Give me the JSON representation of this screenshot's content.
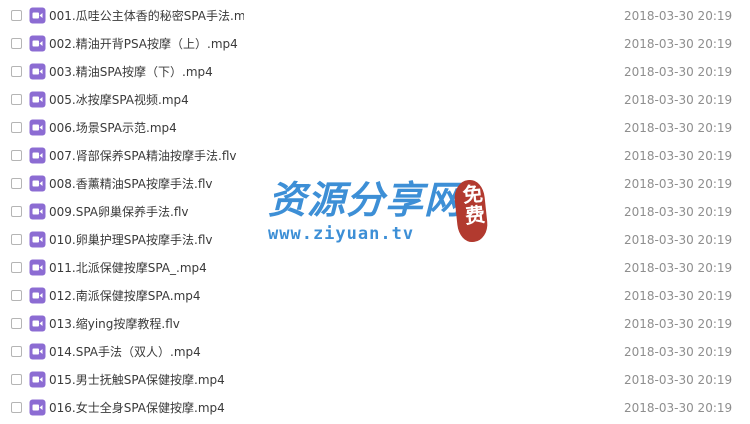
{
  "files": [
    {
      "name": "001.瓜哇公主体香的秘密SPA手法.mp",
      "date": "2018-03-30 20:19"
    },
    {
      "name": "002.精油开背PSA按摩（上）.mp4",
      "date": "2018-03-30 20:19"
    },
    {
      "name": "003.精油SPA按摩（下）.mp4",
      "date": "2018-03-30 20:19"
    },
    {
      "name": "005.冰按摩SPA视频.mp4",
      "date": "2018-03-30 20:19"
    },
    {
      "name": "006.场景SPA示范.mp4",
      "date": "2018-03-30 20:19"
    },
    {
      "name": "007.肾部保养SPA精油按摩手法.flv",
      "date": "2018-03-30 20:19"
    },
    {
      "name": "008.香薰精油SPA按摩手法.flv",
      "date": "2018-03-30 20:19"
    },
    {
      "name": "009.SPA卵巢保养手法.flv",
      "date": "2018-03-30 20:19"
    },
    {
      "name": "010.卵巢护理SPA按摩手法.flv",
      "date": "2018-03-30 20:19"
    },
    {
      "name": "011.北派保健按摩SPA_.mp4",
      "date": "2018-03-30 20:19"
    },
    {
      "name": "012.南派保健按摩SPA.mp4",
      "date": "2018-03-30 20:19"
    },
    {
      "name": "013.缩ying按摩教程.flv",
      "date": "2018-03-30 20:19"
    },
    {
      "name": "014.SPA手法（双人）.mp4",
      "date": "2018-03-30 20:19"
    },
    {
      "name": "015.男士抚触SPA保健按摩.mp4",
      "date": "2018-03-30 20:19"
    },
    {
      "name": "016.女士全身SPA保健按摩.mp4",
      "date": "2018-03-30 20:19"
    }
  ],
  "watermark": {
    "title": "资源分享网",
    "url": "www.ziyuan.tv",
    "badge": "免费"
  },
  "colors": {
    "video_icon": "#8c6cd3",
    "watermark": "#3d8fd6",
    "badge": "#b23a2f"
  },
  "icons": {
    "file": "video-file-icon"
  }
}
